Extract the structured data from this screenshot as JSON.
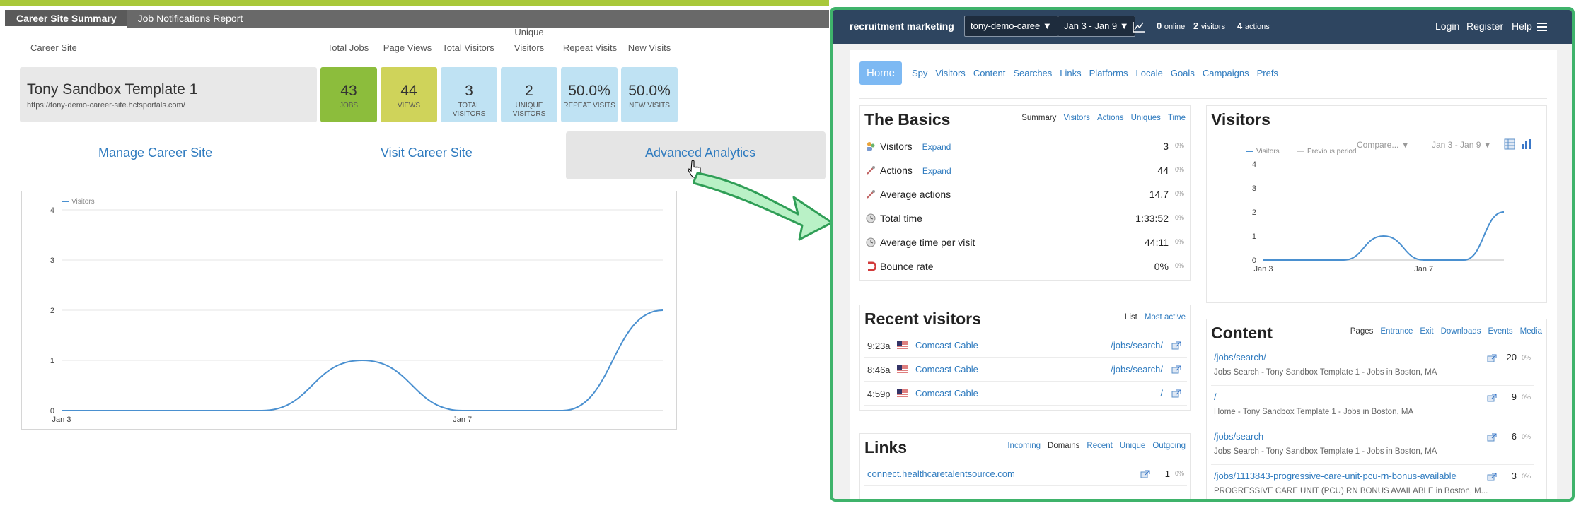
{
  "left": {
    "tabs": [
      "Career Site Summary",
      "Job Notifications Report"
    ],
    "headers": {
      "career_site": "Career Site",
      "total_jobs": "Total Jobs",
      "page_views": "Page Views",
      "total_visitors": "Total Visitors",
      "unique_visitors_1": "Unique",
      "unique_visitors_2": "Visitors",
      "repeat_visits": "Repeat Visits",
      "new_visits": "New Visits"
    },
    "site": {
      "name": "Tony Sandbox Template 1",
      "url": "https://tony-demo-career-site.hctsportals.com/"
    },
    "stats": [
      {
        "num": "43",
        "lbl1": "JOBS",
        "lbl2": ""
      },
      {
        "num": "44",
        "lbl1": "VIEWS",
        "lbl2": ""
      },
      {
        "num": "3",
        "lbl1": "TOTAL",
        "lbl2": "VISITORS"
      },
      {
        "num": "2",
        "lbl1": "UNIQUE",
        "lbl2": "VISITORS"
      },
      {
        "num": "50.0%",
        "lbl1": "REPEAT VISITS",
        "lbl2": ""
      },
      {
        "num": "50.0%",
        "lbl1": "NEW VISITS",
        "lbl2": ""
      }
    ],
    "stat_colors": [
      "#8cbd3c",
      "#cfd35a",
      "#bfe2f3",
      "#bfe2f3",
      "#bfe2f3",
      "#bfe2f3"
    ],
    "links": {
      "manage": "Manage Career Site",
      "visit": "Visit Career Site",
      "advanced": "Advanced Analytics"
    }
  },
  "right": {
    "brand": "recruitment marketing",
    "site_select": "tony-demo-caree ▼",
    "date_select": "Jan 3 - Jan 9 ▼",
    "online": "0",
    "online_label": "online",
    "visitors": "2",
    "visitors_label": "visitors",
    "actions": "4",
    "actions_label": "actions",
    "nav_links": [
      "Login",
      "Register",
      "Help"
    ],
    "pills": [
      "Home",
      "Spy",
      "Visitors",
      "Content",
      "Searches",
      "Links",
      "Platforms",
      "Locale",
      "Goals",
      "Campaigns",
      "Prefs"
    ],
    "basics": {
      "title": "The Basics",
      "tabs": [
        "Summary",
        "Visitors",
        "Actions",
        "Uniques",
        "Time"
      ],
      "rows": [
        {
          "label": "Visitors",
          "expand": "Expand",
          "value": "3",
          "pct": "0%"
        },
        {
          "label": "Actions",
          "expand": "Expand",
          "value": "44",
          "pct": "0%"
        },
        {
          "label": "Average actions",
          "expand": "",
          "value": "14.7",
          "pct": "0%"
        },
        {
          "label": "Total time",
          "expand": "",
          "value": "1:33:52",
          "pct": "0%"
        },
        {
          "label": "Average time per visit",
          "expand": "",
          "value": "44:11",
          "pct": "0%"
        },
        {
          "label": "Bounce rate",
          "expand": "",
          "value": "0%",
          "pct": "0%"
        }
      ]
    },
    "visitors_panel": {
      "title": "Visitors",
      "compare": "Compare... ▼",
      "range": "Jan 3 - Jan 9 ▼",
      "legend": [
        "Visitors",
        "Previous period"
      ]
    },
    "recent": {
      "title": "Recent visitors",
      "tabs": [
        "List",
        "Most active"
      ],
      "rows": [
        {
          "time": "9:23a",
          "isp": "Comcast Cable",
          "path": "/jobs/search/"
        },
        {
          "time": "8:46a",
          "isp": "Comcast Cable",
          "path": "/jobs/search/"
        },
        {
          "time": "4:59p",
          "isp": "Comcast Cable",
          "path": "/"
        }
      ]
    },
    "content": {
      "title": "Content",
      "tabs": [
        "Pages",
        "Entrance",
        "Exit",
        "Downloads",
        "Events",
        "Media"
      ],
      "rows": [
        {
          "path": "/jobs/search/",
          "title": "Jobs Search - Tony Sandbox Template 1 - Jobs in Boston, MA",
          "count": "20",
          "pct": "0%"
        },
        {
          "path": "/",
          "title": "Home - Tony Sandbox Template 1 - Jobs in Boston, MA",
          "count": "9",
          "pct": "0%"
        },
        {
          "path": "/jobs/search",
          "title": "Jobs Search - Tony Sandbox Template 1 - Jobs in Boston, MA",
          "count": "6",
          "pct": "0%"
        },
        {
          "path": "/jobs/1113843-progressive-care-unit-pcu-rn-bonus-available",
          "title": "PROGRESSIVE CARE UNIT (PCU) RN BONUS AVAILABLE in Boston, M...",
          "count": "3",
          "pct": "0%"
        }
      ]
    },
    "links_panel": {
      "title": "Links",
      "tabs": [
        "Incoming",
        "Domains",
        "Recent",
        "Unique",
        "Outgoing"
      ],
      "rows": [
        {
          "domain": "connect.healthcaretalentsource.com",
          "count": "1",
          "pct": "0%"
        }
      ]
    },
    "accent": "#3fb36b"
  },
  "chart_data": [
    {
      "type": "line",
      "title": "",
      "legend": [
        "Visitors"
      ],
      "x": [
        "Jan 3",
        "Jan 4",
        "Jan 5",
        "Jan 6",
        "Jan 7",
        "Jan 8",
        "Jan 9"
      ],
      "x_tick_labels": [
        "Jan 3",
        "Jan 7"
      ],
      "series": [
        {
          "name": "Visitors",
          "values": [
            0,
            0,
            0,
            1,
            0,
            0,
            2
          ]
        }
      ],
      "ylim": [
        0,
        4
      ],
      "y_ticks": [
        0,
        1,
        2,
        3,
        4
      ],
      "grid": true,
      "color": "#4a90d0"
    },
    {
      "type": "line",
      "title": "",
      "legend": [
        "Visitors",
        "Previous period"
      ],
      "x": [
        "Jan 3",
        "Jan 4",
        "Jan 5",
        "Jan 6",
        "Jan 7",
        "Jan 8",
        "Jan 9"
      ],
      "x_tick_labels": [
        "Jan 3",
        "Jan 7"
      ],
      "series": [
        {
          "name": "Visitors",
          "values": [
            0,
            0,
            0,
            1,
            0,
            0,
            2
          ]
        },
        {
          "name": "Previous period",
          "values": [
            0,
            0,
            0,
            0,
            0,
            0,
            0
          ]
        }
      ],
      "ylim": [
        0,
        4
      ],
      "y_ticks": [
        0,
        1,
        2,
        3,
        4
      ],
      "grid": false,
      "color": "#4a90d0"
    }
  ]
}
